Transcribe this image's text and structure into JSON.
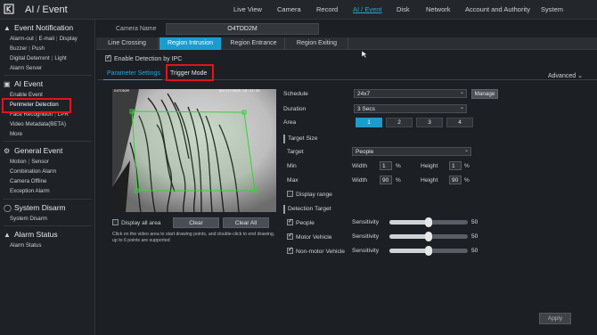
{
  "app": {
    "title": "AI / Event"
  },
  "nav": [
    "Live View",
    "Camera",
    "Record",
    "AI / Event",
    "Disk",
    "Network",
    "Account and Authority",
    "System"
  ],
  "nav_active_index": 3,
  "sidebar": {
    "event_notification": {
      "title": "Event Notification",
      "row1": [
        "Alarm-out",
        "E-mail",
        "Display"
      ],
      "row2": [
        "Buzzer",
        "Push"
      ],
      "row3": [
        "Digital Deterrent",
        "Light"
      ],
      "row4": "Alarm Server"
    },
    "ai_event": {
      "title": "AI Event",
      "items": [
        "Enable Event",
        "Perimeter Detection",
        "Face Recognition",
        "LPR",
        "Video Metadata(BETA)",
        "More"
      ]
    },
    "general_event": {
      "title": "General Event",
      "row1": [
        "Motion",
        "Sensor"
      ],
      "items": [
        "Combination Alarm",
        "Camera Offline",
        "Exception Alarm"
      ]
    },
    "system_disarm": {
      "title": "System Disarm",
      "items": [
        "System Disarm"
      ]
    },
    "alarm_status": {
      "title": "Alarm Status",
      "items": [
        "Alarm Status"
      ]
    }
  },
  "camera": {
    "label": "Camera Name",
    "value": "O4TDD2M"
  },
  "tabs": [
    "Line Crossing",
    "Region Intrusion",
    "Region Entrance",
    "Region Exiting"
  ],
  "tab_active_index": 1,
  "enable_detection": {
    "label": "Enable Detection by IPC",
    "checked": true
  },
  "subtabs": {
    "param": "Parameter Settings",
    "trigger": "Trigger Mode",
    "advanced": "Advanced"
  },
  "video": {
    "osd_left": "O4TDD2M",
    "osd_right": "04/17/2025 16:13:38"
  },
  "video_controls": {
    "display_all_area": "Display all area",
    "clear": "Clear",
    "clear_all": "Clear All",
    "hint": "Click on the video area to start drawing points, and double-click to end drawing, up to 6 points are supported"
  },
  "form": {
    "schedule": {
      "label": "Schedule",
      "value": "24x7",
      "manage": "Manage"
    },
    "duration": {
      "label": "Duration",
      "value": "3 Secs"
    },
    "area": {
      "label": "Area",
      "options": [
        "1",
        "2",
        "3",
        "4"
      ],
      "selected": 0
    },
    "target_size": {
      "section": "Target Size",
      "target_label": "Target",
      "target_value": "People",
      "min_label": "Min",
      "max_label": "Max",
      "width_label": "Width",
      "height_label": "Height",
      "min_width": "1",
      "min_height": "1",
      "max_width": "90",
      "max_height": "90",
      "unit": "%",
      "display_range": "Display range"
    },
    "detection_target": {
      "section": "Detection Target",
      "sensitivity_label": "Sensitivity",
      "items": [
        {
          "label": "People",
          "checked": true,
          "sensitivity": 50
        },
        {
          "label": "Motor Vehicle",
          "checked": true,
          "sensitivity": 50
        },
        {
          "label": "Non-motor Vehicle",
          "checked": true,
          "sensitivity": 50
        }
      ]
    }
  },
  "apply": "Apply"
}
